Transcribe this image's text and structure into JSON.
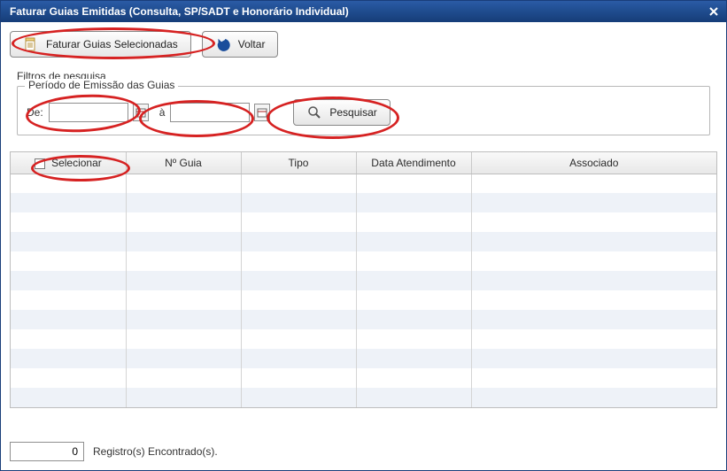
{
  "window": {
    "title": "Faturar Guias Emitidas (Consulta, SP/SADT e Honorário Individual)",
    "close_label": "×"
  },
  "toolbar": {
    "faturar_label": "Faturar Guias Selecionadas",
    "voltar_label": "Voltar"
  },
  "filters": {
    "section_title": "Filtros de pesquisa",
    "legend": "Período de Emissão das Guias",
    "de_label": "De:",
    "a_label": "à",
    "de_value": "",
    "a_value": "",
    "pesquisar_label": "Pesquisar"
  },
  "grid": {
    "columns": {
      "selecionar": "Selecionar",
      "n_guia": "Nº Guia",
      "tipo": "Tipo",
      "data_atendimento": "Data Atendimento",
      "associado": "Associado"
    }
  },
  "footer": {
    "count_value": "0",
    "count_label": "Registro(s) Encontrado(s)."
  }
}
